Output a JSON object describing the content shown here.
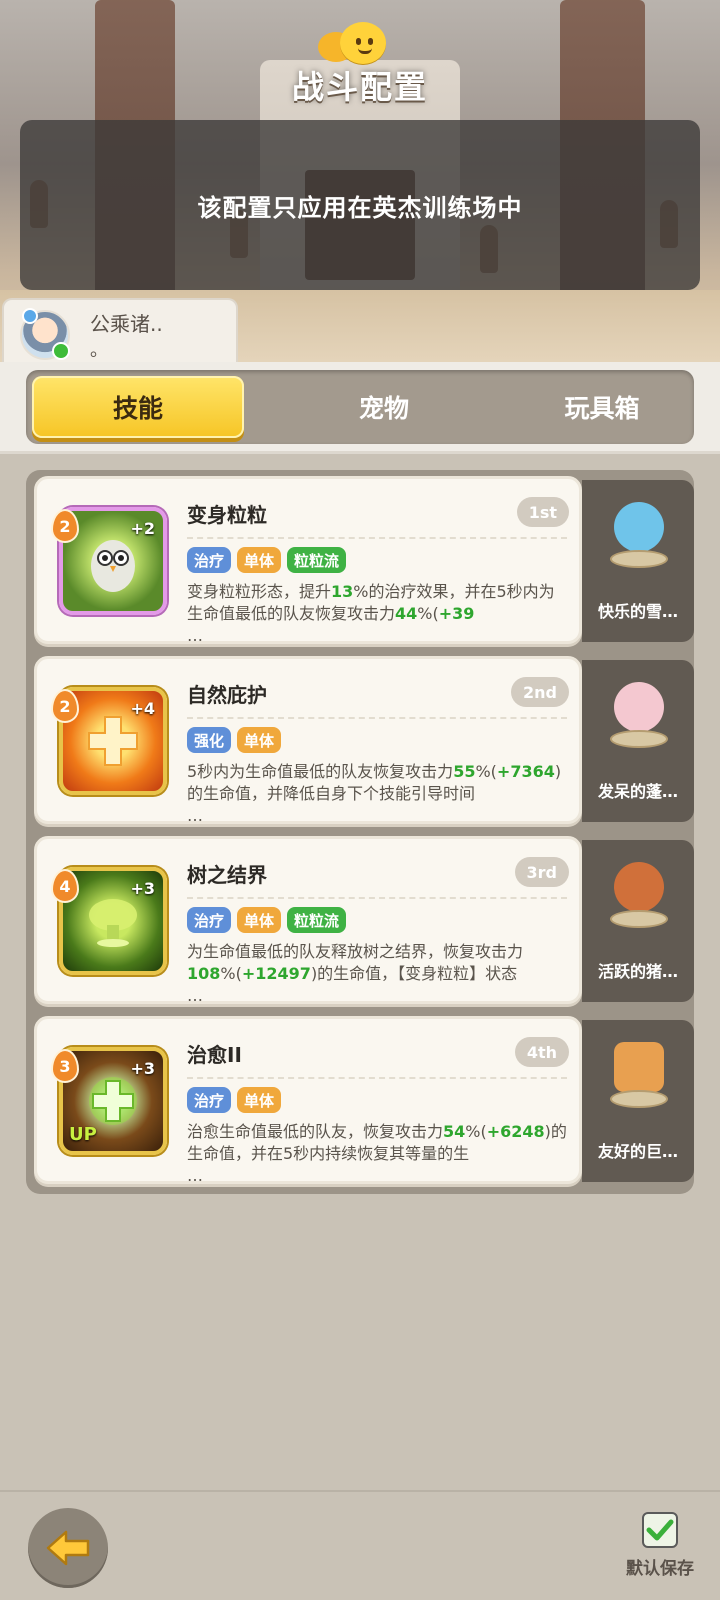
{
  "header": {
    "title": "战斗配置",
    "chat_label": "聊天",
    "notice": "该配置只应用在英杰训练场中"
  },
  "player": {
    "name_line1": "公乘诸..",
    "name_line2": "。"
  },
  "tabs": [
    {
      "label": "技能",
      "active": true
    },
    {
      "label": "宠物",
      "active": false
    },
    {
      "label": "玩具箱",
      "active": false
    }
  ],
  "skills": [
    {
      "level": "2",
      "plus": "+2",
      "name": "变身粒粒",
      "rank": "1st",
      "tags": [
        "治疗",
        "单体",
        "粒粒流"
      ],
      "desc_parts": [
        "变身粒粒形态，提升",
        "13",
        "%的治疗效果，并在5秒内为生命值最低的队友恢复攻击力",
        "44",
        "%(",
        "+39",
        "",
        "",
        "…"
      ],
      "pet_name": "快乐的雪…"
    },
    {
      "level": "2",
      "plus": "+4",
      "name": "自然庇护",
      "rank": "2nd",
      "tags": [
        "强化",
        "单体"
      ],
      "desc_parts": [
        "5秒内为生命值最低的队友恢复攻击力",
        "55",
        "%(",
        "+7364",
        ")的生命值，并降低自身下个技能引导时间",
        "",
        "",
        "",
        "…"
      ],
      "pet_name": "发呆的蓬…"
    },
    {
      "level": "4",
      "plus": "+3",
      "name": "树之结界",
      "rank": "3rd",
      "tags": [
        "治疗",
        "单体",
        "粒粒流"
      ],
      "desc_parts": [
        "为生命值最低的队友释放树之结界，恢复攻击力",
        "108",
        "%(",
        "+12497",
        ")的生命值，【变身粒粒】状态",
        "",
        "",
        "",
        "…"
      ],
      "pet_name": "活跃的猪…"
    },
    {
      "level": "3",
      "plus": "+3",
      "name": "治愈II",
      "rank": "4th",
      "tags": [
        "治疗",
        "单体"
      ],
      "desc_parts": [
        "治愈生命值最低的队友，恢复攻击力",
        "54",
        "%(",
        "+6248",
        ")的生命值，并在5秒内持续恢复其等量的生",
        "",
        "",
        "",
        "…"
      ],
      "pet_name": "友好的巨…",
      "up_label": "UP"
    }
  ],
  "bottom": {
    "save_label": "默认保存"
  },
  "colors": {
    "tab_active": "#f6c525",
    "tag_blue": "#5f8fd8",
    "tag_orange": "#f0a83c",
    "tag_green": "#3fb244",
    "highlight_green": "#2ea62e"
  },
  "icons": {
    "back": "back-arrow-icon",
    "save": "checkmark-icon",
    "chat": "chat-bubble-icon"
  }
}
